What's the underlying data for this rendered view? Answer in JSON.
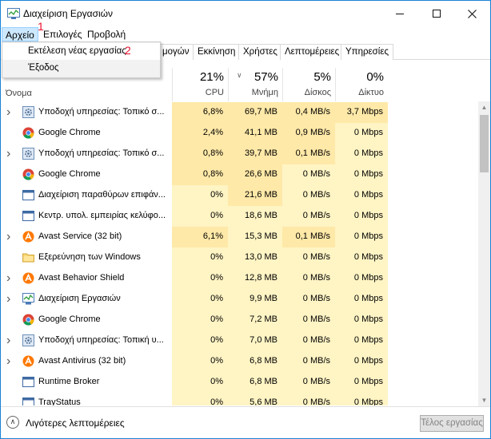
{
  "window": {
    "title": "Διαχείριση Εργασιών"
  },
  "menu": {
    "file": "Αρχείο",
    "options": "Επιλογές",
    "view": "Προβολή"
  },
  "annotations": {
    "one": "1",
    "two": "2"
  },
  "file_menu": {
    "run_new_task": "Εκτέλεση νέας εργασίας",
    "exit": "Έξοδος"
  },
  "tabs": [
    "μογών",
    "Εκκίνηση",
    "Χρήστες",
    "Λεπτομέρειες",
    "Υπηρεσίες"
  ],
  "columns": {
    "name": "Όνομα",
    "cpu": {
      "pct": "21%",
      "label": "CPU"
    },
    "memory": {
      "pct": "57%",
      "label": "Μνήμη"
    },
    "disk": {
      "pct": "5%",
      "label": "Δίσκος"
    },
    "network": {
      "pct": "0%",
      "label": "Δίκτυο"
    }
  },
  "colors": {
    "heat_light": "#fff4c4",
    "heat_mid": "#ffe9a8",
    "heat_strong": "#ffd980",
    "accent": "#1883d7"
  },
  "processes": [
    {
      "name": "Υποδοχή υπηρεσίας: Τοπικό σ...",
      "icon": "gear-icon",
      "expandable": true,
      "cpu": "6,8%",
      "memory": "69,7 MB",
      "disk": "0,4 MB/s",
      "network": "3,7 Mbps"
    },
    {
      "name": "Google Chrome",
      "icon": "chrome-icon",
      "expandable": false,
      "cpu": "2,4%",
      "memory": "41,1 MB",
      "disk": "0,9 MB/s",
      "network": "0 Mbps"
    },
    {
      "name": "Υποδοχή υπηρεσίας: Τοπικό σ...",
      "icon": "gear-icon",
      "expandable": true,
      "cpu": "0,8%",
      "memory": "39,7 MB",
      "disk": "0,1 MB/s",
      "network": "0 Mbps"
    },
    {
      "name": "Google Chrome",
      "icon": "chrome-icon",
      "expandable": false,
      "cpu": "0,8%",
      "memory": "26,6 MB",
      "disk": "0 MB/s",
      "network": "0 Mbps"
    },
    {
      "name": "Διαχείριση παραθύρων επιφάν...",
      "icon": "window-icon",
      "expandable": false,
      "cpu": "0%",
      "memory": "21,6 MB",
      "disk": "0 MB/s",
      "network": "0 Mbps"
    },
    {
      "name": "Κεντρ. υπολ. εμπειρίας κελύφο...",
      "icon": "window-icon",
      "expandable": false,
      "cpu": "0%",
      "memory": "18,6 MB",
      "disk": "0 MB/s",
      "network": "0 Mbps"
    },
    {
      "name": "Avast Service (32 bit)",
      "icon": "avast-icon",
      "expandable": true,
      "cpu": "6,1%",
      "memory": "15,3 MB",
      "disk": "0,1 MB/s",
      "network": "0 Mbps"
    },
    {
      "name": "Εξερεύνηση των Windows",
      "icon": "folder-icon",
      "expandable": false,
      "cpu": "0%",
      "memory": "13,0 MB",
      "disk": "0 MB/s",
      "network": "0 Mbps"
    },
    {
      "name": "Avast Behavior Shield",
      "icon": "avast-icon",
      "expandable": true,
      "cpu": "0%",
      "memory": "12,8 MB",
      "disk": "0 MB/s",
      "network": "0 Mbps"
    },
    {
      "name": "Διαχείριση Εργασιών",
      "icon": "taskmgr-icon",
      "expandable": true,
      "cpu": "0%",
      "memory": "9,9 MB",
      "disk": "0 MB/s",
      "network": "0 Mbps"
    },
    {
      "name": "Google Chrome",
      "icon": "chrome-icon",
      "expandable": false,
      "cpu": "0%",
      "memory": "7,2 MB",
      "disk": "0 MB/s",
      "network": "0 Mbps"
    },
    {
      "name": "Υποδοχή υπηρεσίας: Τοπική υ...",
      "icon": "gear-icon",
      "expandable": true,
      "cpu": "0%",
      "memory": "7,0 MB",
      "disk": "0 MB/s",
      "network": "0 Mbps"
    },
    {
      "name": "Avast Antivirus (32 bit)",
      "icon": "avast-icon",
      "expandable": true,
      "cpu": "0%",
      "memory": "6,8 MB",
      "disk": "0 MB/s",
      "network": "0 Mbps"
    },
    {
      "name": "Runtime Broker",
      "icon": "window-icon",
      "expandable": false,
      "cpu": "0%",
      "memory": "6,8 MB",
      "disk": "0 MB/s",
      "network": "0 Mbps"
    },
    {
      "name": "TrayStatus",
      "icon": "window-icon",
      "expandable": false,
      "cpu": "0%",
      "memory": "5,6 MB",
      "disk": "0 MB/s",
      "network": "0 Mbps"
    }
  ],
  "footer": {
    "fewer_details": "Λιγότερες λεπτομέρειες",
    "end_task": "Τέλος εργασίας"
  }
}
